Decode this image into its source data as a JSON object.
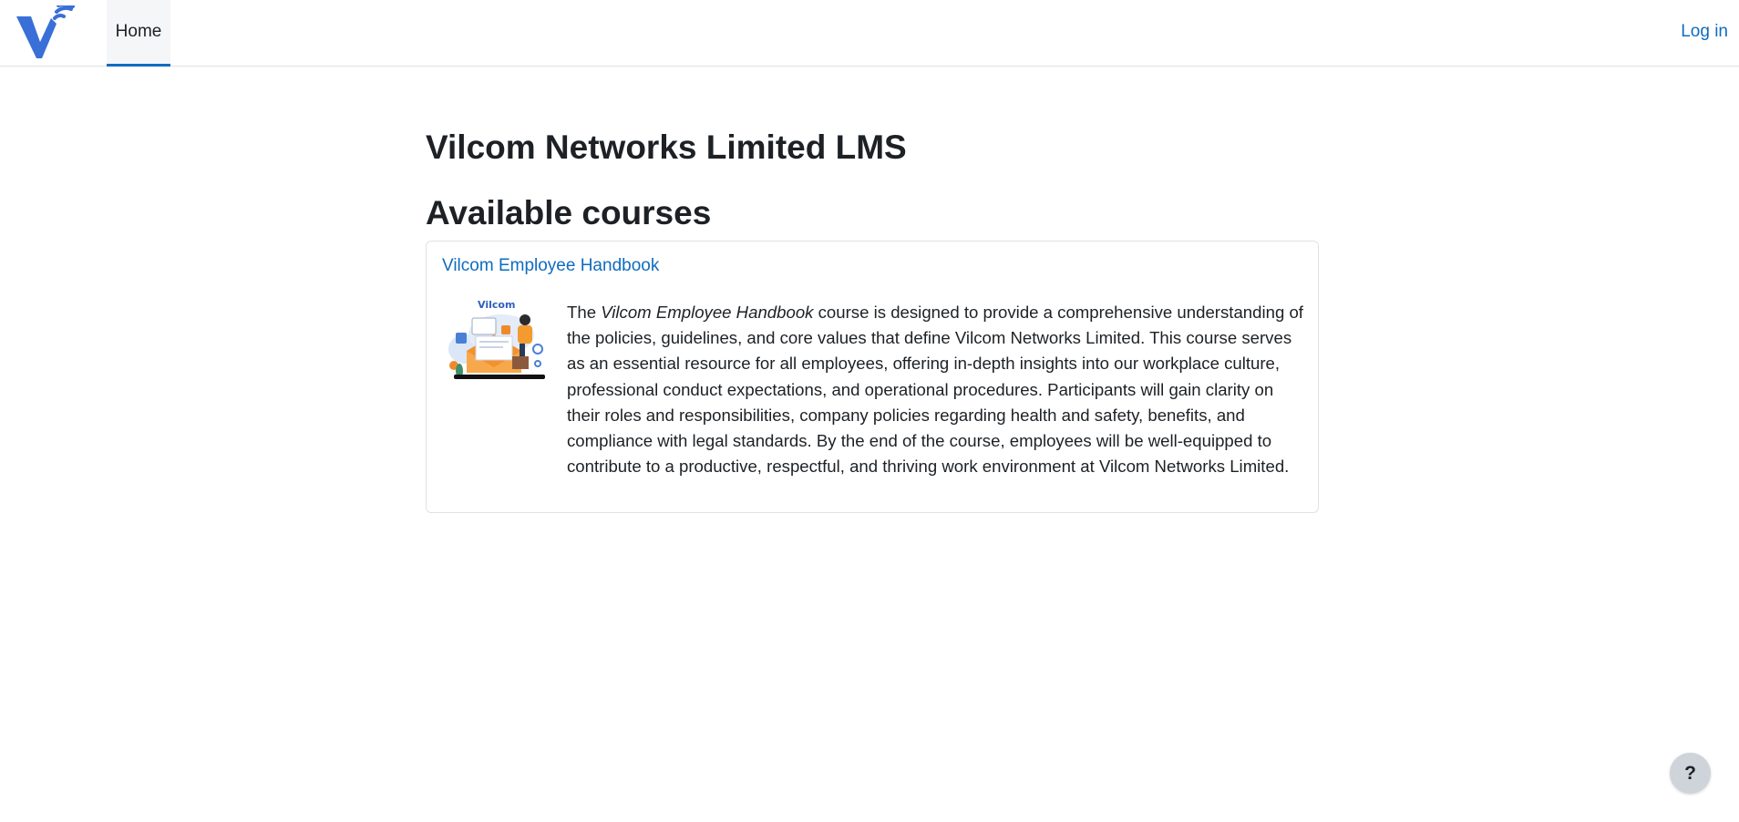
{
  "navbar": {
    "logo_icon": "vilcom-logo-icon",
    "home_label": "Home",
    "login_label": "Log in"
  },
  "site": {
    "title": "Vilcom Networks Limited LMS"
  },
  "courses": {
    "heading": "Available courses",
    "items": [
      {
        "name": "Vilcom Employee Handbook",
        "image_icon": "course-illustration-icon",
        "image_logo_text": "Vilcom",
        "summary_prefix": "The ",
        "summary_emphasis": "Vilcom Employee Handbook",
        "summary_rest": " course is designed to provide a comprehensive understanding of the policies, guidelines, and core values that define Vilcom Networks Limited. This course serves as an essential resource for all employees, offering in-depth insights into our workplace culture, professional conduct expectations, and operational procedures. Participants will gain clarity on their roles and responsibilities, company policies regarding health and safety, benefits, and compliance with legal standards. By the end of the course, employees will be well-equipped to contribute to a productive, respectful, and thriving work environment at Vilcom Networks Limited."
      }
    ]
  },
  "help": {
    "label": "?",
    "icon": "help-icon"
  },
  "colors": {
    "accent": "#0f6cbf",
    "logo_blue": "#3a6fd8",
    "text": "#1d2125",
    "border": "#dee2e6"
  }
}
